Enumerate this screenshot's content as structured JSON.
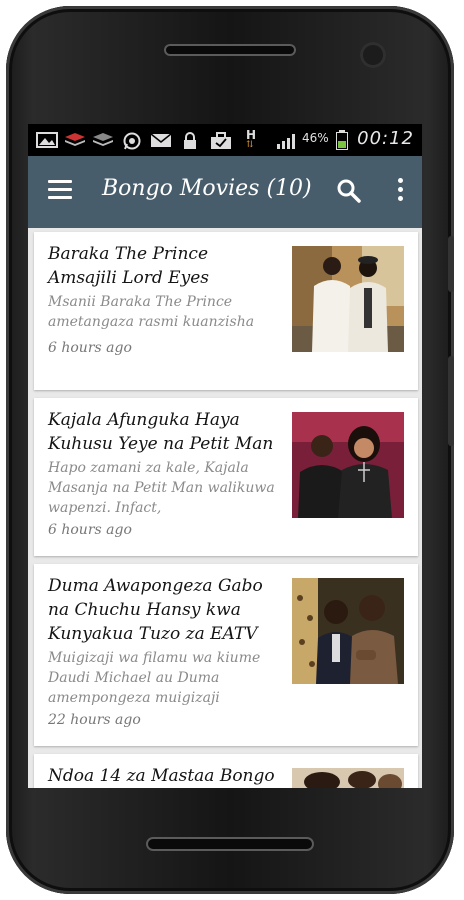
{
  "status_bar": {
    "battery_percent": "46%",
    "time": "00:12",
    "network_label": "H"
  },
  "app_bar": {
    "title": "Bongo Movies (10)"
  },
  "articles": [
    {
      "title": "Baraka The Prince Amsajili Lord Eyes",
      "summary": "Msanii Baraka The Prince ametangaza rasmi kuanzisha label yake na kutaja wasanii",
      "time": "6 hours ago"
    },
    {
      "title": "Kajala Afunguka Haya Kuhusu Yeye na Petit Man",
      "summary": "Hapo zamani za kale, Kajala Masanja na Petit Man walikuwa wapenzi. Infact,",
      "time": "6 hours ago"
    },
    {
      "title": "Duma Awapongeza Gabo na Chuchu Hansy kwa Kunyakua Tuzo za EATV",
      "summary": "Muigizaji wa filamu wa kiume Daudi Michael au Duma amempongeza muigizaji",
      "time": "22 hours ago"
    },
    {
      "title": "Ndoa 14 za Mastaa Bongo",
      "summary": "",
      "time": ""
    }
  ],
  "colors": {
    "app_bar": "#485d6b",
    "status_bar": "#000000",
    "list_background": "#e9e9e9",
    "battery_fill": "#7cc242"
  }
}
